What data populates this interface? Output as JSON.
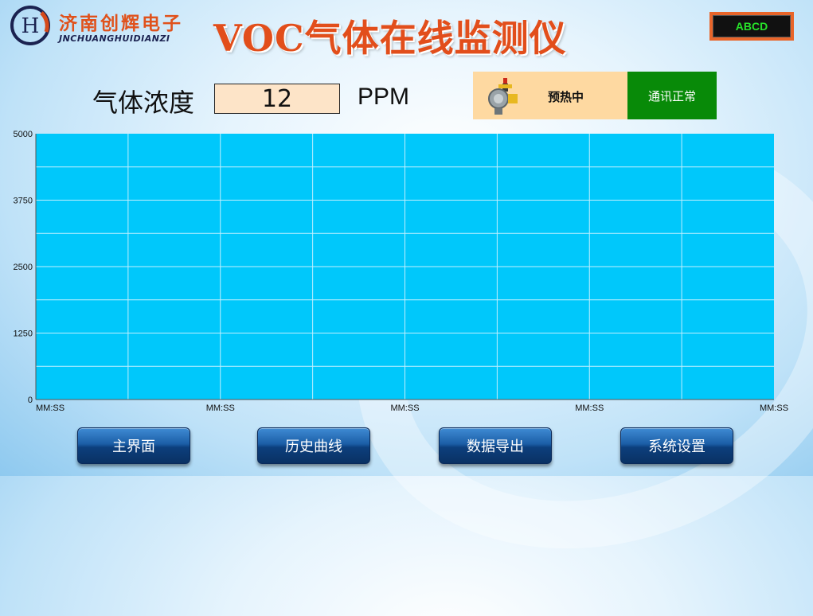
{
  "header": {
    "logo_letter": "H",
    "company_cn": "济南创辉电子",
    "company_en": "JNCHUANGHUIDIANZI",
    "title": "VOC气体在线监测仪",
    "badge": "ABCD"
  },
  "reading": {
    "label": "气体浓度",
    "value": "12",
    "unit": "PPM"
  },
  "status": {
    "state": "预热中",
    "comm": "通讯正常"
  },
  "colors": {
    "plot_bg": "#00c8fb",
    "accent": "#e24e1b",
    "comm_ok": "#088a08",
    "status_bg": "#fed9a1"
  },
  "chart_data": {
    "type": "line",
    "y_ticks": [
      "5000",
      "3750",
      "2500",
      "1250",
      "0"
    ],
    "ylim": [
      0,
      5000
    ],
    "x_ticks": [
      "MM:SS",
      "MM:SS",
      "MM:SS",
      "MM:SS",
      "MM:SS"
    ],
    "grid": true,
    "series": []
  },
  "buttons": [
    {
      "label": "主界面"
    },
    {
      "label": "历史曲线"
    },
    {
      "label": "数据导出"
    },
    {
      "label": "系统设置"
    }
  ]
}
